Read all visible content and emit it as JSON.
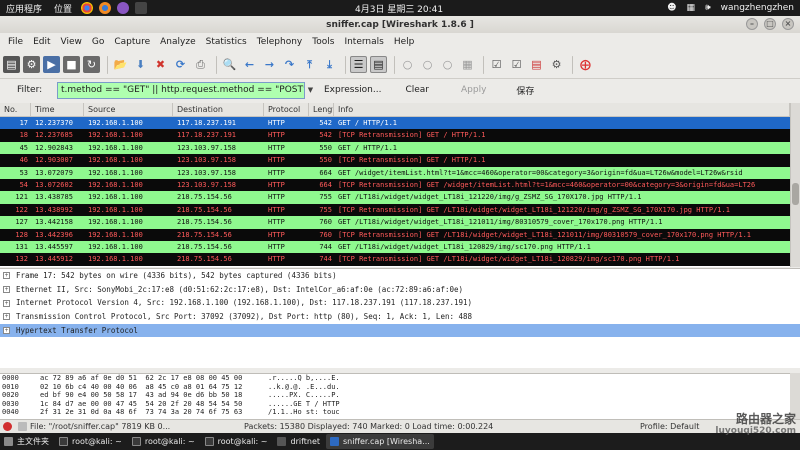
{
  "topbar": {
    "apps_label": "应用程序",
    "places_label": "位置",
    "clock": "4月3日 星期三 20:41",
    "user": "wangzhengzhen"
  },
  "window": {
    "title": "sniffer.cap   [Wireshark 1.8.6 ]"
  },
  "menu": [
    "File",
    "Edit",
    "View",
    "Go",
    "Capture",
    "Analyze",
    "Statistics",
    "Telephony",
    "Tools",
    "Internals",
    "Help"
  ],
  "toolbar": {
    "icons": [
      "interface-list-icon",
      "capture-options-icon",
      "start-capture-icon",
      "stop-capture-icon",
      "restart-capture-icon",
      "open-file-icon",
      "save-file-icon",
      "close-file-icon",
      "reload-icon",
      "print-icon",
      "find-icon",
      "back-icon",
      "forward-icon",
      "goto-icon",
      "first-packet-icon",
      "last-packet-icon",
      "colorize-icon",
      "autoscroll-icon",
      "zoom-in-icon",
      "zoom-out-icon",
      "zoom-normal-icon",
      "resize-columns-icon",
      "capture-filters-icon",
      "display-filters-icon",
      "coloring-rules-icon",
      "preferences-icon",
      "help-icon"
    ]
  },
  "filter": {
    "label": "Filter:",
    "value": "t.method == \"GET\" || http.request.method == \"POST\"",
    "expression": "Expression...",
    "clear": "Clear",
    "apply": "Apply",
    "save": "保存",
    "bg_color": "#afffaf"
  },
  "columns": [
    "No.",
    "Time",
    "Source",
    "Destination",
    "Protocol",
    "Lengtl",
    "Info"
  ],
  "packets": [
    {
      "no": "17",
      "time": "12.237370",
      "src": "192.168.1.100",
      "dst": "117.18.237.191",
      "proto": "HTTP",
      "len": "542",
      "info": "GET / HTTP/1.1",
      "style": "selected"
    },
    {
      "no": "18",
      "time": "12.237685",
      "src": "192.168.1.100",
      "dst": "117.18.237.191",
      "proto": "HTTP",
      "len": "542",
      "info": "[TCP Retransmission] GET / HTTP/1.1",
      "style": "black"
    },
    {
      "no": "45",
      "time": "12.902843",
      "src": "192.168.1.100",
      "dst": "123.103.97.158",
      "proto": "HTTP",
      "len": "550",
      "info": "GET / HTTP/1.1",
      "style": "green"
    },
    {
      "no": "46",
      "time": "12.903007",
      "src": "192.168.1.100",
      "dst": "123.103.97.158",
      "proto": "HTTP",
      "len": "550",
      "info": "[TCP Retransmission] GET / HTTP/1.1",
      "style": "black"
    },
    {
      "no": "53",
      "time": "13.072079",
      "src": "192.168.1.100",
      "dst": "123.103.97.158",
      "proto": "HTTP",
      "len": "664",
      "info": "GET /widget/itemList.html?t=1&mcc=460&operator=00&category=3&origin=fd&ua=LT26w&model=LT26w&rsid",
      "style": "green"
    },
    {
      "no": "54",
      "time": "13.072602",
      "src": "192.168.1.100",
      "dst": "123.103.97.158",
      "proto": "HTTP",
      "len": "664",
      "info": "[TCP Retransmission] GET /widget/itemList.html?t=1&mcc=460&operator=00&category=3&origin=fd&ua=LT26",
      "style": "black"
    },
    {
      "no": "121",
      "time": "13.438785",
      "src": "192.168.1.100",
      "dst": "218.75.154.56",
      "proto": "HTTP",
      "len": "755",
      "info": "GET /LT18i/widget/widget_LT18i_121220/img/g_ZSMZ_SG_170X170.jpg HTTP/1.1",
      "style": "green"
    },
    {
      "no": "122",
      "time": "13.438992",
      "src": "192.168.1.100",
      "dst": "218.75.154.56",
      "proto": "HTTP",
      "len": "755",
      "info": "[TCP Retransmission] GET /LT18i/widget/widget_LT18i_121220/img/g_ZSMZ_SG_170X170.jpg HTTP/1.1",
      "style": "black"
    },
    {
      "no": "127",
      "time": "13.442158",
      "src": "192.168.1.100",
      "dst": "218.75.154.56",
      "proto": "HTTP",
      "len": "760",
      "info": "GET /LT18i/widget/widget_LT18i_121011/img/80310579_cover_170x170.png HTTP/1.1",
      "style": "green"
    },
    {
      "no": "128",
      "time": "13.442396",
      "src": "192.168.1.100",
      "dst": "218.75.154.56",
      "proto": "HTTP",
      "len": "760",
      "info": "[TCP Retransmission] GET /LT18i/widget/widget_LT18i_121011/img/80310579_cover_170x170.png HTTP/1.1",
      "style": "black"
    },
    {
      "no": "131",
      "time": "13.445597",
      "src": "192.168.1.100",
      "dst": "218.75.154.56",
      "proto": "HTTP",
      "len": "744",
      "info": "GET /LT18i/widget/widget_LT18i_120829/img/sc170.png HTTP/1.1",
      "style": "green"
    },
    {
      "no": "132",
      "time": "13.445912",
      "src": "192.168.1.100",
      "dst": "218.75.154.56",
      "proto": "HTTP",
      "len": "744",
      "info": "[TCP Retransmission] GET /LT18i/widget/widget_LT18i_120829/img/sc170.png HTTP/1.1",
      "style": "black"
    }
  ],
  "details": [
    {
      "text": "Frame 17: 542 bytes on wire (4336 bits), 542 bytes captured (4336 bits)",
      "selected": false
    },
    {
      "text": "Ethernet II, Src: SonyMobi_2c:17:e8 (d0:51:62:2c:17:e8), Dst: IntelCor_a6:af:0e (ac:72:89:a6:af:0e)",
      "selected": false
    },
    {
      "text": "Internet Protocol Version 4, Src: 192.168.1.100 (192.168.1.100), Dst: 117.18.237.191 (117.18.237.191)",
      "selected": false
    },
    {
      "text": "Transmission Control Protocol, Src Port: 37092 (37092), Dst Port: http (80), Seq: 1, Ack: 1, Len: 488",
      "selected": false
    },
    {
      "text": "Hypertext Transfer Protocol",
      "selected": true
    }
  ],
  "hex": [
    {
      "off": "0000",
      "bytes": "ac 72 89 a6 af 0e d0 51  62 2c 17 e8 08 00 45 00",
      "ascii": ".r.....Q b,....E."
    },
    {
      "off": "0010",
      "bytes": "02 10 6b c4 40 00 40 06  a8 45 c0 a8 01 64 75 12",
      "ascii": "..k.@.@. .E...du."
    },
    {
      "off": "0020",
      "bytes": "ed bf 90 e4 00 50 58 17  43 ad 94 0e d6 bb 50 18",
      "ascii": ".....PX. C.....P."
    },
    {
      "off": "0030",
      "bytes": "1c 84 d7 ae 00 00 47 45  54 20 2f 20 48 54 54 50",
      "ascii": "......GE T / HTTP"
    },
    {
      "off": "0040",
      "bytes": "2f 31 2e 31 0d 0a 48 6f  73 74 3a 20 74 6f 75 63",
      "ascii": "/1.1..Ho st: touc"
    }
  ],
  "status": {
    "file": "File: \"/root/sniffer.cap\" 7819 KB 0...",
    "stats": "Packets: 15380 Displayed: 740 Marked: 0 Load time: 0:00.224",
    "profile": "Profile: Default"
  },
  "taskbar": [
    {
      "label": "主文件夹",
      "active": false
    },
    {
      "label": "root@kali: ~",
      "active": false
    },
    {
      "label": "root@kali: ~",
      "active": false
    },
    {
      "label": "root@kali: ~",
      "active": false
    },
    {
      "label": "driftnet",
      "active": false
    },
    {
      "label": "sniffer.cap   [Wiresha...",
      "active": true
    }
  ],
  "watermark": {
    "line1": "路由器之家",
    "line2": "luyouqi520.com"
  }
}
